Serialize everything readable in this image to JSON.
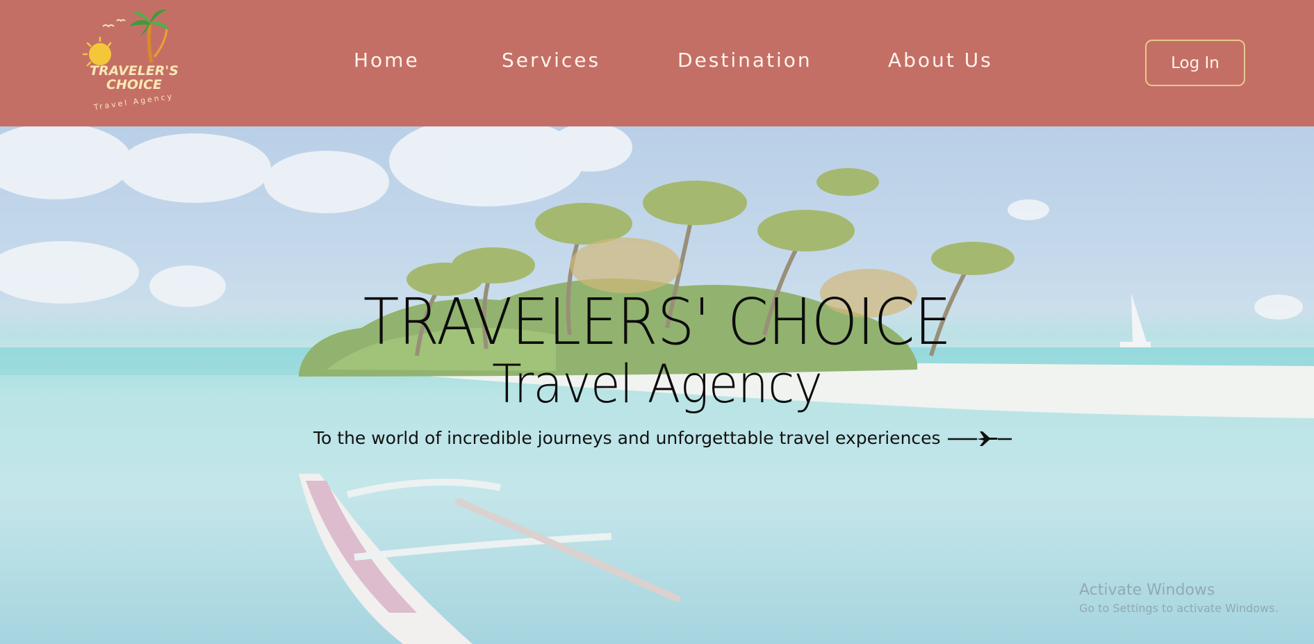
{
  "logo": {
    "line1": "TRAVELER'S",
    "line2": "CHOICE",
    "line3": "Travel Agency",
    "icon": "palm-sun-logo"
  },
  "nav": {
    "items": [
      {
        "label": "Home"
      },
      {
        "label": "Services"
      },
      {
        "label": "Destination"
      },
      {
        "label": "About Us"
      }
    ],
    "login_label": "Log In"
  },
  "hero": {
    "title": "TRAVELERS' CHOICE",
    "subtitle": "Travel Agency",
    "tagline": "To the world of incredible journeys and unforgettable travel experiences",
    "tagline_icon": "airplane-icon"
  },
  "watermark": {
    "line1": "Activate Windows",
    "line2": "Go to Settings to activate Windows."
  },
  "colors": {
    "header_bg": "#c46f66",
    "nav_text": "#fff4ec",
    "login_border": "#e7c98e",
    "logo_yellow": "#f4c73a",
    "logo_green": "#3f9a3a"
  }
}
